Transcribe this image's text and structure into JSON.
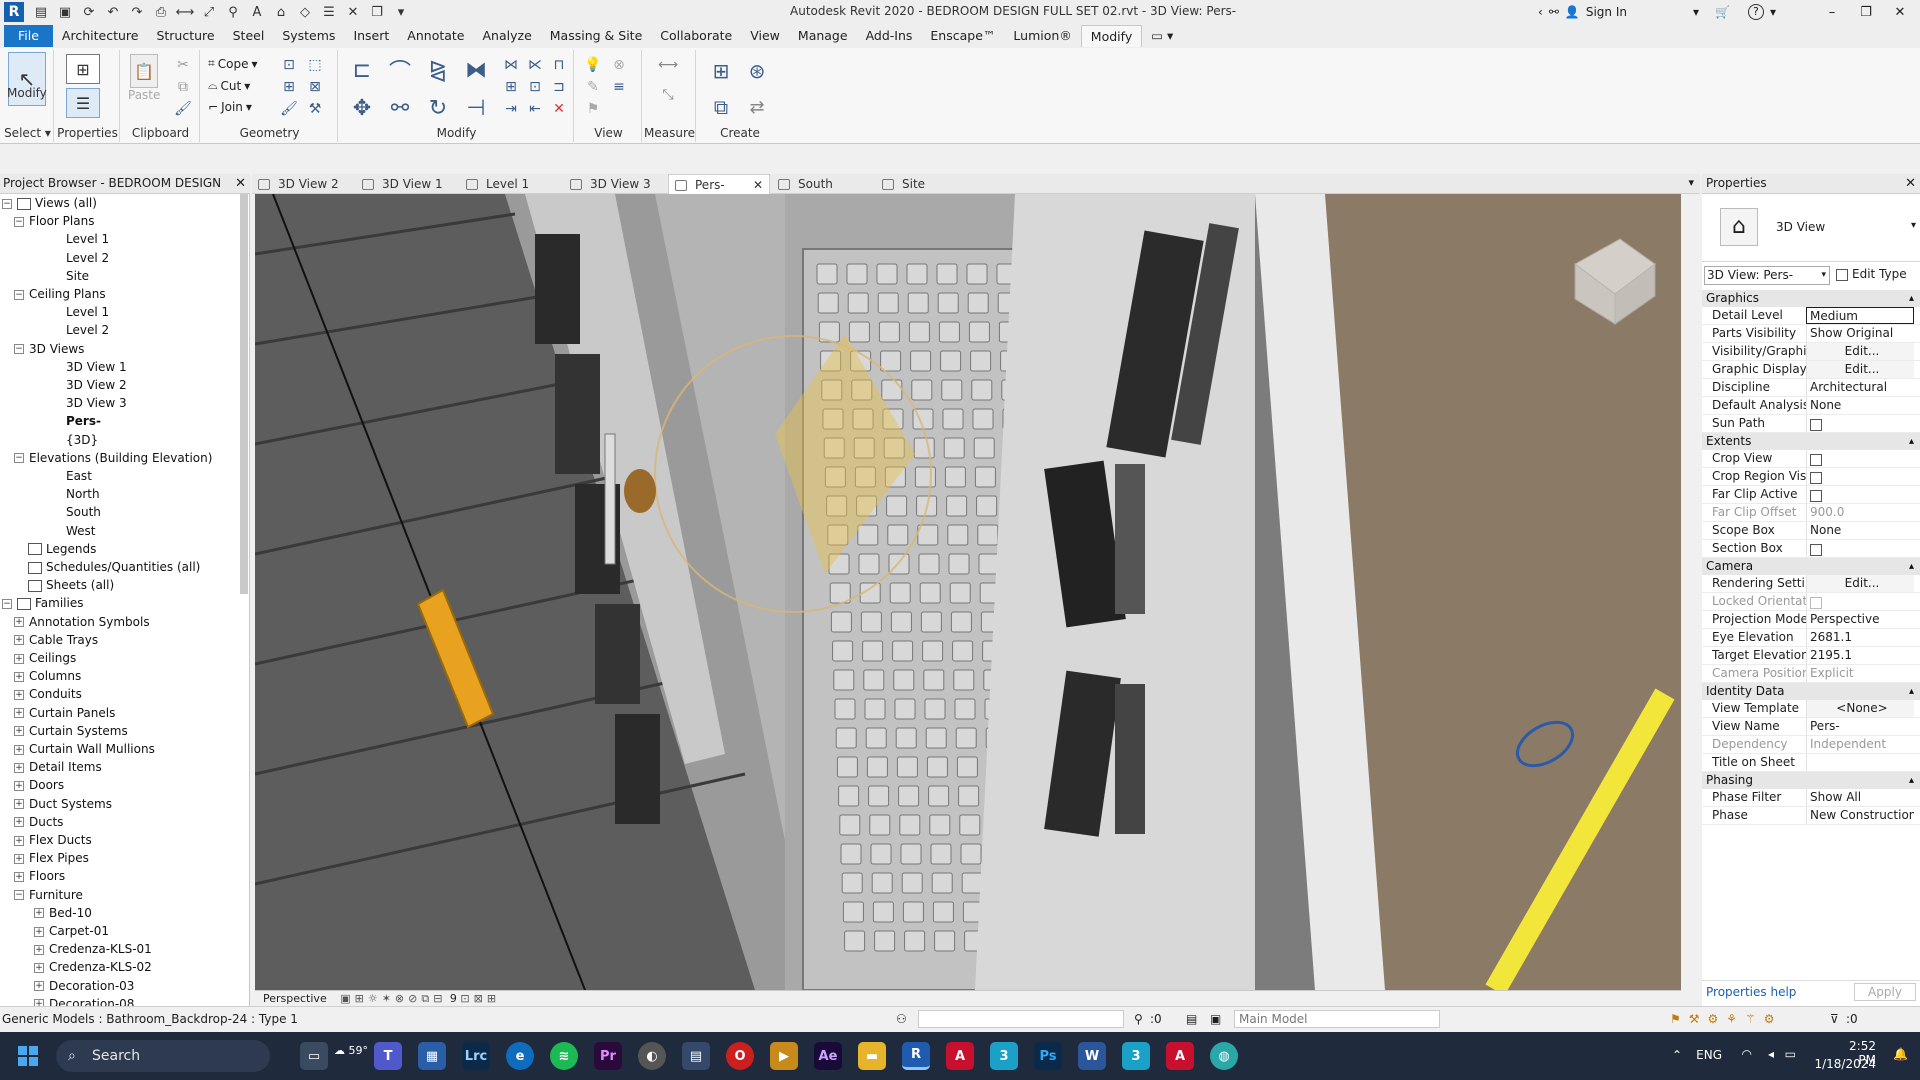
{
  "title_bar": {
    "window_title": "Autodesk Revit 2020 - BEDROOM DESIGN FULL SET 02.rvt - 3D View: Pers-",
    "sign_in": "Sign In",
    "help": "?"
  },
  "menu": {
    "tabs": [
      "File",
      "Architecture",
      "Structure",
      "Steel",
      "Systems",
      "Insert",
      "Annotate",
      "Analyze",
      "Massing & Site",
      "Collaborate",
      "View",
      "Manage",
      "Add-Ins",
      "Enscape™",
      "Lumion®",
      "Modify"
    ],
    "active": "Modify"
  },
  "ribbon": {
    "modify_label": "Modify",
    "properties_label": "Properties",
    "paste_label": "Paste",
    "cope_label": "Cope",
    "cut_label": "Cut",
    "join_label": "Join",
    "groups": {
      "select": "Select",
      "properties": "Properties",
      "clipboard": "Clipboard",
      "geometry": "Geometry",
      "modify": "Modify",
      "view": "View",
      "measure": "Measure",
      "create": "Create"
    }
  },
  "project_browser": {
    "title": "Project Browser - BEDROOM DESIGN FUL...",
    "items": [
      {
        "label": "Views (all)",
        "level": 0,
        "exp": "−",
        "icon": true
      },
      {
        "label": "Floor Plans",
        "level": 1,
        "exp": "−"
      },
      {
        "label": "Level 1",
        "level": 2
      },
      {
        "label": "Level 2",
        "level": 2
      },
      {
        "label": "Site",
        "level": 2
      },
      {
        "label": "Ceiling Plans",
        "level": 1,
        "exp": "−"
      },
      {
        "label": "Level 1",
        "level": 2
      },
      {
        "label": "Level 2",
        "level": 2
      },
      {
        "label": "3D Views",
        "level": 1,
        "exp": "−"
      },
      {
        "label": "3D View 1",
        "level": 2
      },
      {
        "label": "3D View 2",
        "level": 2
      },
      {
        "label": "3D View 3",
        "level": 2
      },
      {
        "label": "Pers-",
        "level": 2,
        "bold": true
      },
      {
        "label": "{3D}",
        "level": 2
      },
      {
        "label": "Elevations (Building Elevation)",
        "level": 1,
        "exp": "−"
      },
      {
        "label": "East",
        "level": 2
      },
      {
        "label": "North",
        "level": 2
      },
      {
        "label": "South",
        "level": 2
      },
      {
        "label": "West",
        "level": 2
      },
      {
        "label": "Legends",
        "level": 0,
        "icon": true
      },
      {
        "label": "Schedules/Quantities (all)",
        "level": 0,
        "icon": true
      },
      {
        "label": "Sheets (all)",
        "level": 0,
        "icon": true
      },
      {
        "label": "Families",
        "level": 0,
        "exp": "−",
        "icon": true
      },
      {
        "label": "Annotation Symbols",
        "level": 1,
        "exp": "+"
      },
      {
        "label": "Cable Trays",
        "level": 1,
        "exp": "+"
      },
      {
        "label": "Ceilings",
        "level": 1,
        "exp": "+"
      },
      {
        "label": "Columns",
        "level": 1,
        "exp": "+"
      },
      {
        "label": "Conduits",
        "level": 1,
        "exp": "+"
      },
      {
        "label": "Curtain Panels",
        "level": 1,
        "exp": "+"
      },
      {
        "label": "Curtain Systems",
        "level": 1,
        "exp": "+"
      },
      {
        "label": "Curtain Wall Mullions",
        "level": 1,
        "exp": "+"
      },
      {
        "label": "Detail Items",
        "level": 1,
        "exp": "+"
      },
      {
        "label": "Doors",
        "level": 1,
        "exp": "+"
      },
      {
        "label": "Duct Systems",
        "level": 1,
        "exp": "+"
      },
      {
        "label": "Ducts",
        "level": 1,
        "exp": "+"
      },
      {
        "label": "Flex Ducts",
        "level": 1,
        "exp": "+"
      },
      {
        "label": "Flex Pipes",
        "level": 1,
        "exp": "+"
      },
      {
        "label": "Floors",
        "level": 1,
        "exp": "+"
      },
      {
        "label": "Furniture",
        "level": 1,
        "exp": "−"
      },
      {
        "label": "Bed-10",
        "level": 2,
        "exp": "+"
      },
      {
        "label": "Carpet-01",
        "level": 2,
        "exp": "+"
      },
      {
        "label": "Credenza-KLS-01",
        "level": 2,
        "exp": "+"
      },
      {
        "label": "Credenza-KLS-02",
        "level": 2,
        "exp": "+"
      },
      {
        "label": "Decoration-03",
        "level": 2,
        "exp": "+"
      },
      {
        "label": "Decoration-08",
        "level": 2,
        "exp": "+"
      }
    ]
  },
  "view_tabs": [
    {
      "label": "3D View 2"
    },
    {
      "label": "3D View 1"
    },
    {
      "label": "Level 1"
    },
    {
      "label": "3D View 3"
    },
    {
      "label": "Pers-",
      "active": true
    },
    {
      "label": "South"
    },
    {
      "label": "Site"
    }
  ],
  "view_bar": {
    "projection": "Perspective",
    "scale_num": "9"
  },
  "properties": {
    "title": "Properties",
    "type_name": "3D View",
    "view_selector": "3D View: Pers-",
    "edit_type": "Edit Type",
    "help_link": "Properties help",
    "apply": "Apply",
    "sections": [
      {
        "name": "Graphics",
        "rows": [
          {
            "n": "Detail Level",
            "v": "Medium",
            "boxed": true
          },
          {
            "n": "Parts Visibility",
            "v": "Show Original"
          },
          {
            "n": "Visibility/Graphi...",
            "v": "Edit...",
            "btn": true
          },
          {
            "n": "Graphic Display...",
            "v": "Edit...",
            "btn": true
          },
          {
            "n": "Discipline",
            "v": "Architectural"
          },
          {
            "n": "Default Analysis...",
            "v": "None"
          },
          {
            "n": "Sun Path",
            "cb": true
          }
        ]
      },
      {
        "name": "Extents",
        "rows": [
          {
            "n": "Crop View",
            "cb": true
          },
          {
            "n": "Crop Region Vis...",
            "cb": true
          },
          {
            "n": "Far Clip Active",
            "cb": true
          },
          {
            "n": "Far Clip Offset",
            "v": "900.0",
            "dis": true
          },
          {
            "n": "Scope Box",
            "v": "None"
          },
          {
            "n": "Section Box",
            "cb": true
          }
        ]
      },
      {
        "name": "Camera",
        "rows": [
          {
            "n": "Rendering Setti...",
            "v": "Edit...",
            "btn": true
          },
          {
            "n": "Locked Orientat...",
            "cb": true,
            "dis": true
          },
          {
            "n": "Projection Mode",
            "v": "Perspective"
          },
          {
            "n": "Eye Elevation",
            "v": "2681.1"
          },
          {
            "n": "Target Elevation",
            "v": "2195.1"
          },
          {
            "n": "Camera Position",
            "v": "Explicit",
            "dis": true
          }
        ]
      },
      {
        "name": "Identity Data",
        "rows": [
          {
            "n": "View Template",
            "v": "<None>",
            "btn": true
          },
          {
            "n": "View Name",
            "v": "Pers-"
          },
          {
            "n": "Dependency",
            "v": "Independent",
            "dis": true
          },
          {
            "n": "Title on Sheet",
            "v": ""
          }
        ]
      },
      {
        "name": "Phasing",
        "rows": [
          {
            "n": "Phase Filter",
            "v": "Show All"
          },
          {
            "n": "Phase",
            "v": "New Construction"
          }
        ]
      }
    ]
  },
  "status_bar": {
    "selection": "Generic Models : Bathroom_Backdrop-24 : Type 1",
    "counter": ":0",
    "model": "Main Model",
    "filter_count": ":0"
  },
  "taskbar": {
    "search": "Search",
    "weather": "59°",
    "language": "ENG",
    "time": "2:52 PM",
    "date": "1/18/2024",
    "apps": [
      "Lrc",
      "Pr",
      "Ae",
      "Ps",
      "W"
    ]
  },
  "colors": {
    "file_tab": "#1a74c8",
    "taskbar": "#1f2a3c",
    "accent_orange": "#e8a21f",
    "accent_yellow": "#f3e63b"
  }
}
